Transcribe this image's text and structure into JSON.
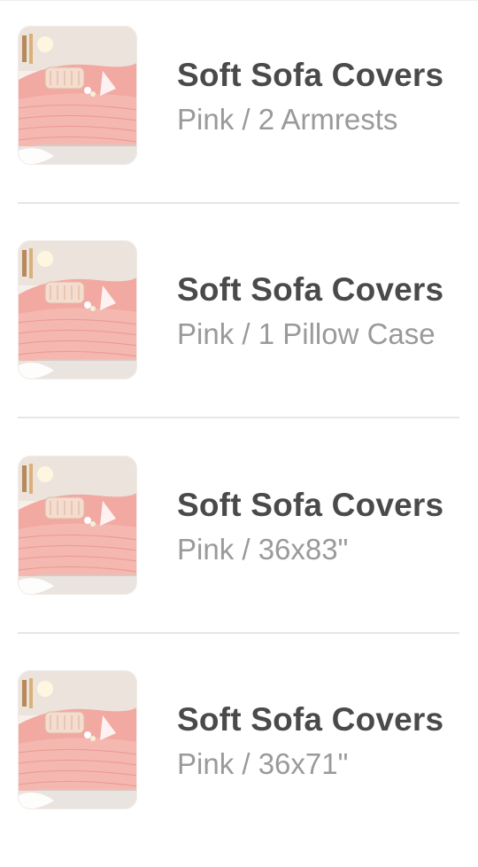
{
  "cart": {
    "items": [
      {
        "title": "Soft Sofa Covers",
        "variant": "Pink / 2 Armrests",
        "image_icon": "sofa-cover-thumbnail"
      },
      {
        "title": "Soft Sofa Covers",
        "variant": "Pink / 1 Pillow Case",
        "image_icon": "sofa-cover-thumbnail"
      },
      {
        "title": "Soft Sofa Covers",
        "variant": "Pink / 36x83\"",
        "image_icon": "sofa-cover-thumbnail"
      },
      {
        "title": "Soft Sofa Covers",
        "variant": "Pink / 36x71\"",
        "image_icon": "sofa-cover-thumbnail"
      }
    ]
  },
  "colors": {
    "title": "#4a4a4a",
    "variant": "#9a9a9a",
    "divider": "#e6e6e6",
    "sofa_pink": "#f2a9a2"
  }
}
